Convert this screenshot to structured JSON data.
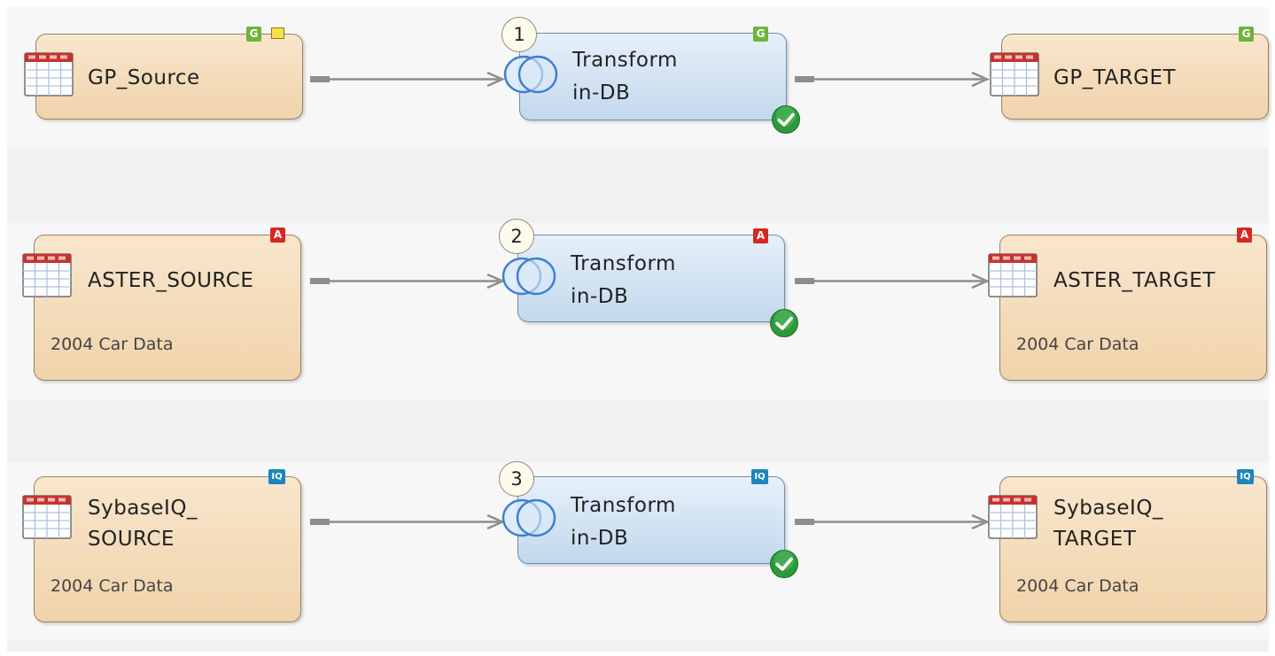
{
  "rows": [
    {
      "source": {
        "label_lines": [
          "GP_Source"
        ],
        "subtitle": "",
        "badge": "G",
        "has_note": true
      },
      "transform": {
        "label_lines": [
          "Transform",
          "in-DB"
        ],
        "sequence": "1",
        "badge": "G",
        "status": "success"
      },
      "target": {
        "label_lines": [
          "GP_TARGET"
        ],
        "subtitle": "",
        "badge": "G"
      }
    },
    {
      "source": {
        "label_lines": [
          "ASTER_SOURCE"
        ],
        "subtitle": "2004 Car Data",
        "badge": "A",
        "has_note": false
      },
      "transform": {
        "label_lines": [
          "Transform",
          "in-DB"
        ],
        "sequence": "2",
        "badge": "A",
        "status": "success"
      },
      "target": {
        "label_lines": [
          "ASTER_TARGET"
        ],
        "subtitle": "2004 Car Data",
        "badge": "A"
      }
    },
    {
      "source": {
        "label_lines": [
          "SybaseIQ_",
          "SOURCE"
        ],
        "subtitle": "2004 Car Data",
        "badge": "IQ",
        "has_note": false
      },
      "transform": {
        "label_lines": [
          "Transform",
          "in-DB"
        ],
        "sequence": "3",
        "badge": "IQ",
        "status": "success"
      },
      "target": {
        "label_lines": [
          "SybaseIQ_",
          "TARGET"
        ],
        "subtitle": "2004 Car Data",
        "badge": "IQ"
      }
    }
  ],
  "icons": {
    "table": "table-icon",
    "transform": "transform-in-db-icon",
    "status_success": "green-check-icon",
    "note": "note-icon"
  },
  "colors": {
    "table_fill": "#f0d3ab",
    "transform_fill": "#c3d8ec",
    "badge_g": "#6fb33c",
    "badge_a": "#d72820",
    "badge_iq": "#1b86bd",
    "check": "#2c9a3a",
    "arrow": "#8d8d8d"
  }
}
